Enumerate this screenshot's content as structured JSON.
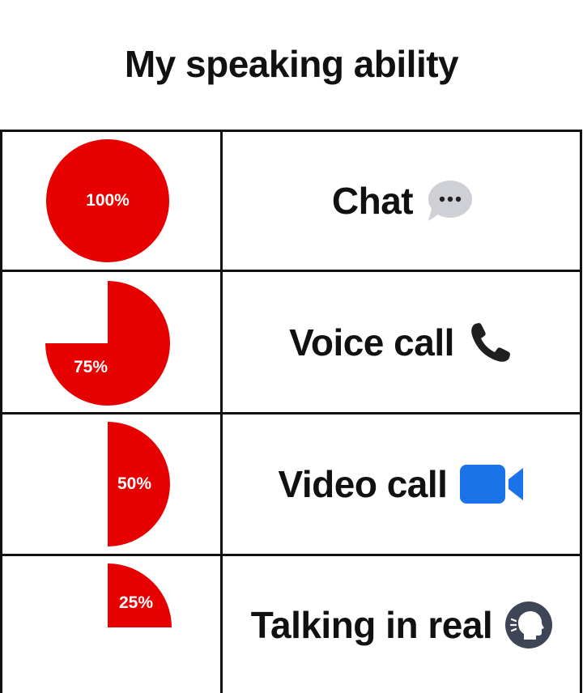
{
  "title": "My speaking ability",
  "colors": {
    "pie": "#e60000",
    "border": "#111111"
  },
  "rows": [
    {
      "percent": 100,
      "percent_label": "100%",
      "label": "Chat",
      "icon": "speech-bubble-icon"
    },
    {
      "percent": 75,
      "percent_label": "75%",
      "label": "Voice call",
      "icon": "phone-icon"
    },
    {
      "percent": 50,
      "percent_label": "50%",
      "label": "Video call",
      "icon": "video-camera-icon"
    },
    {
      "percent": 25,
      "percent_label": "25%",
      "label": "Talking in real",
      "icon": "speaking-head-icon"
    }
  ]
}
